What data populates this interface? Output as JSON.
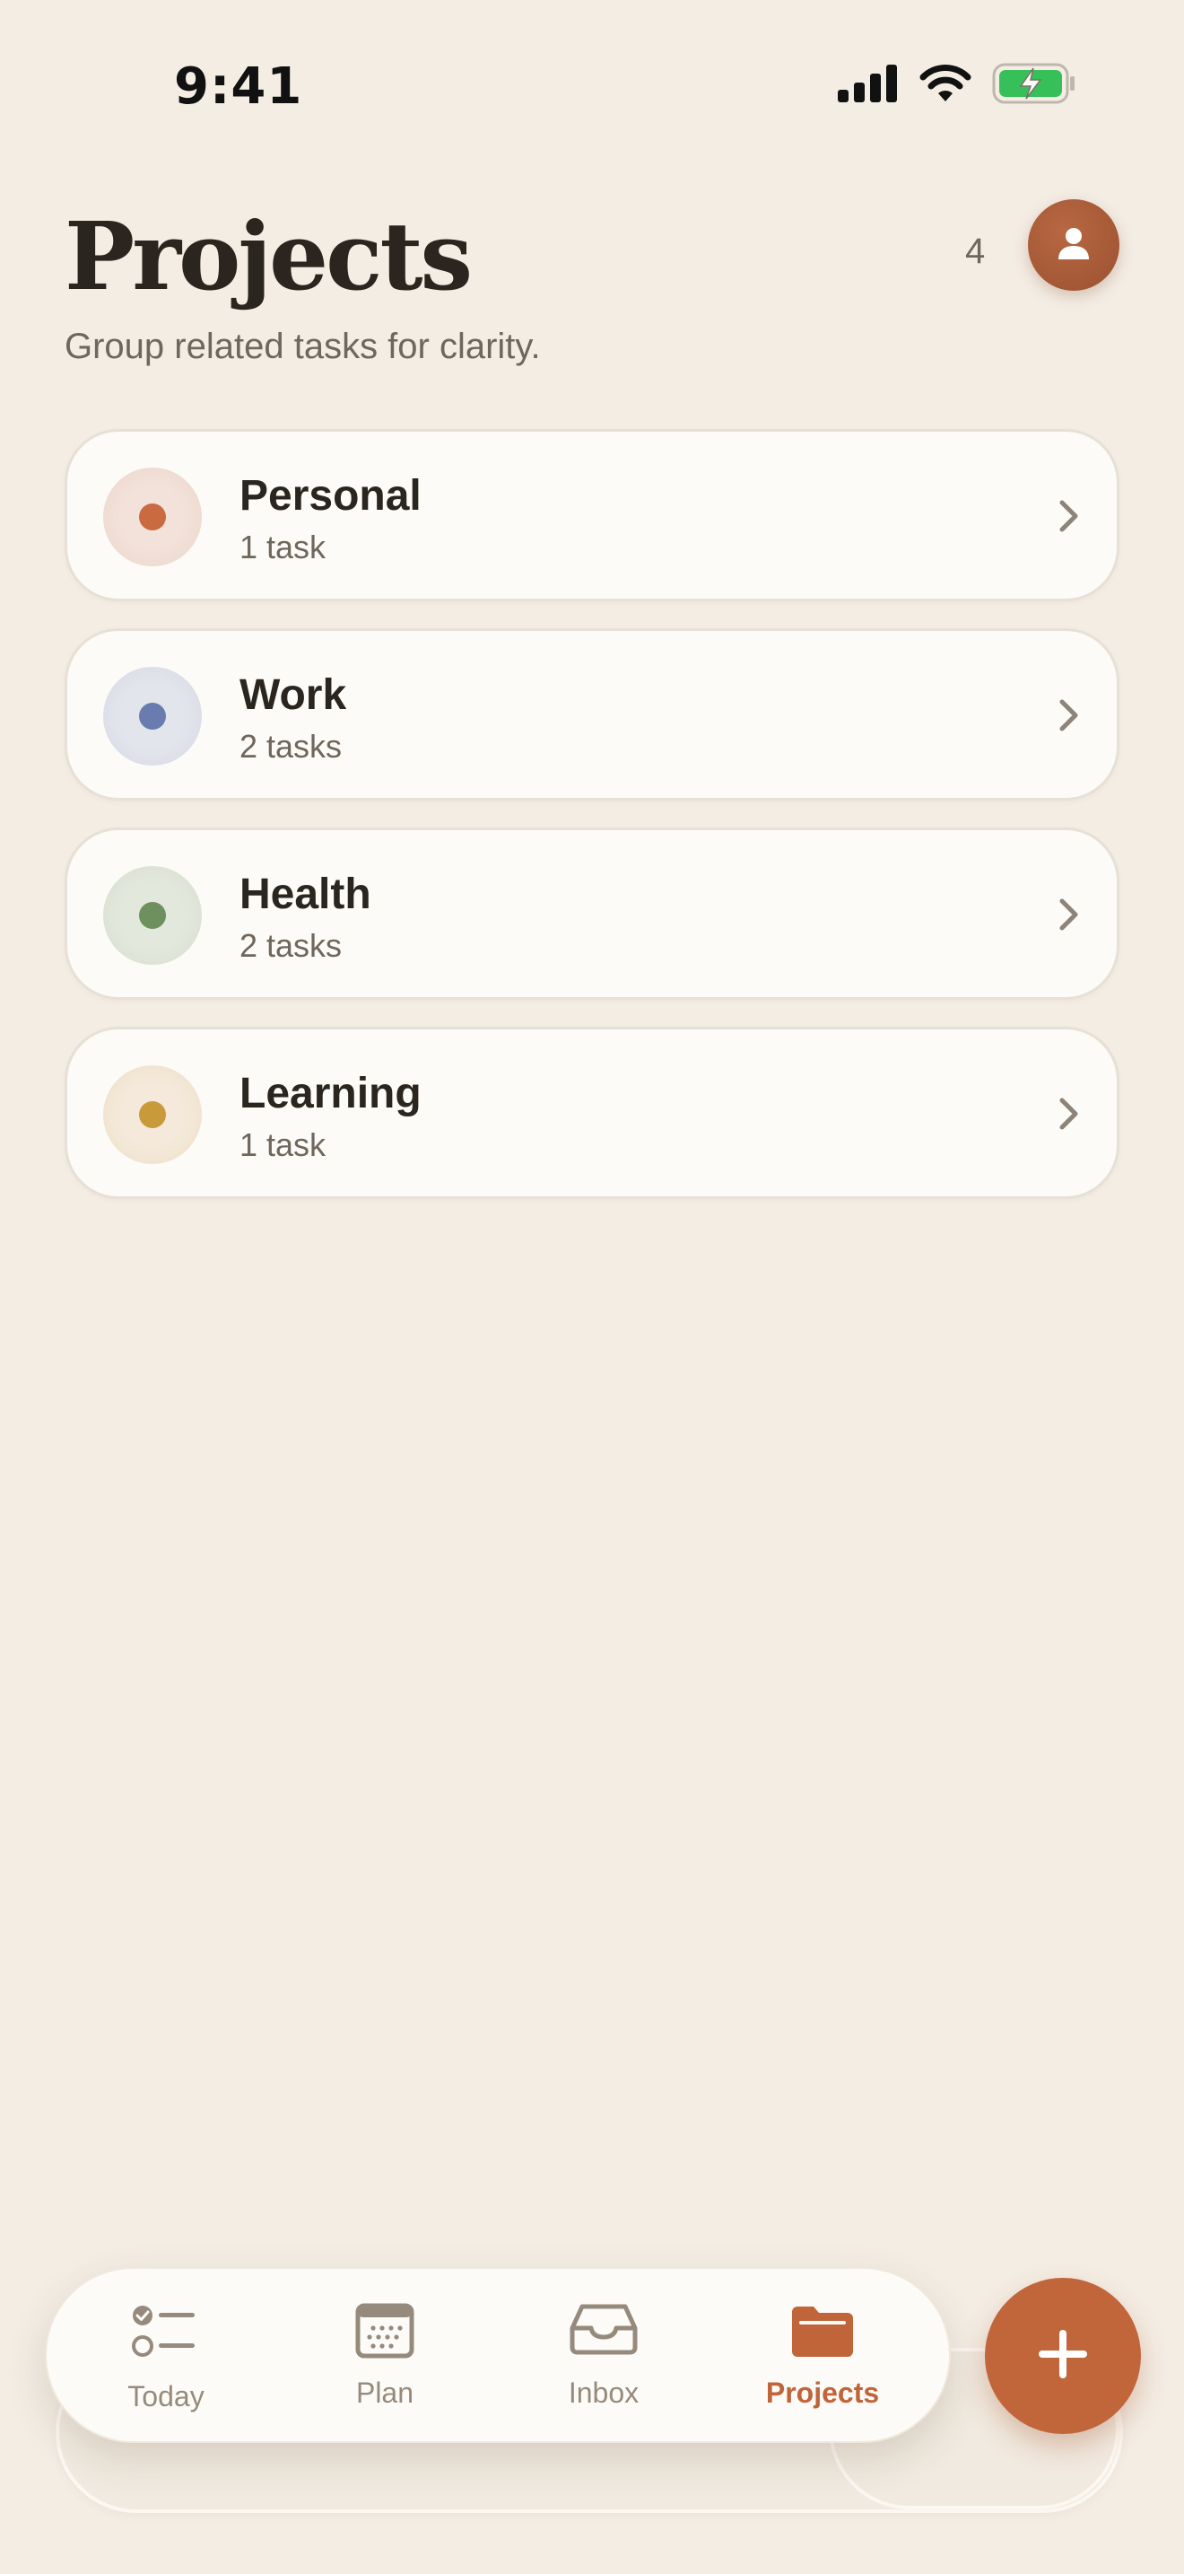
{
  "status_bar": {
    "time": "9:41"
  },
  "header": {
    "title": "Projects",
    "subtitle": "Group related tasks for clarity.",
    "count": "4",
    "avatar_icon": "person-icon"
  },
  "projects": [
    {
      "name": "Personal",
      "tasks": "1 task",
      "color": "#C96A40",
      "ring": "#F2E2DA"
    },
    {
      "name": "Work",
      "tasks": "2 tasks",
      "color": "#6A7CAF",
      "ring": "#E3E5EC"
    },
    {
      "name": "Health",
      "tasks": "2 tasks",
      "color": "#6E8F5E",
      "ring": "#E3E8DD"
    },
    {
      "name": "Learning",
      "tasks": "1 task",
      "color": "#C99A3A",
      "ring": "#F4E9DA"
    }
  ],
  "nav": {
    "items": [
      {
        "label": "Today",
        "icon": "checklist-icon",
        "active": false
      },
      {
        "label": "Plan",
        "icon": "calendar-icon",
        "active": false
      },
      {
        "label": "Inbox",
        "icon": "inbox-icon",
        "active": false
      },
      {
        "label": "Projects",
        "icon": "folder-icon",
        "active": true
      }
    ]
  },
  "fab": {
    "icon": "plus-icon"
  },
  "colors": {
    "background": "#F4EDE4",
    "accent": "#C1653B",
    "card": "#FDFBF7",
    "muted_text": "#6F665C"
  }
}
